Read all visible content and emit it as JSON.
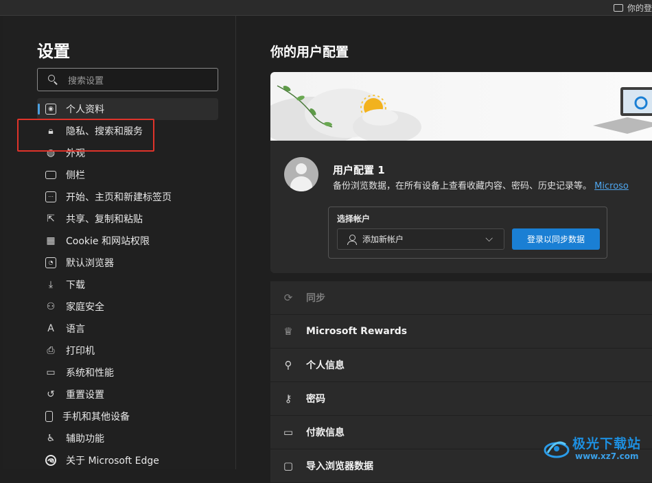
{
  "topbar": {
    "profile_label": "你的登"
  },
  "sidebar": {
    "title": "设置",
    "search_placeholder": "搜索设置",
    "items": [
      {
        "label": "个人资料",
        "icon": "profile-icon",
        "active": true
      },
      {
        "label": "隐私、搜索和服务",
        "icon": "lock-icon"
      },
      {
        "label": "外观",
        "icon": "palette-icon"
      },
      {
        "label": "侧栏",
        "icon": "sidebar-panel-icon"
      },
      {
        "label": "开始、主页和新建标签页",
        "icon": "home-tab-icon"
      },
      {
        "label": "共享、复制和粘贴",
        "icon": "share-icon"
      },
      {
        "label": "Cookie 和网站权限",
        "icon": "cookie-permissions-icon"
      },
      {
        "label": "默认浏览器",
        "icon": "default-browser-icon"
      },
      {
        "label": "下载",
        "icon": "download-icon"
      },
      {
        "label": "家庭安全",
        "icon": "family-icon"
      },
      {
        "label": "语言",
        "icon": "language-icon"
      },
      {
        "label": "打印机",
        "icon": "printer-icon"
      },
      {
        "label": "系统和性能",
        "icon": "laptop-icon"
      },
      {
        "label": "重置设置",
        "icon": "reset-icon"
      },
      {
        "label": "手机和其他设备",
        "icon": "phone-icon"
      },
      {
        "label": "辅助功能",
        "icon": "accessibility-icon"
      },
      {
        "label": "关于 Microsoft Edge",
        "icon": "edge-logo-icon"
      }
    ]
  },
  "main": {
    "title": "你的用户配置",
    "profile": {
      "name": "用户配置 1",
      "description": "备份浏览数据，在所有设备上查看收藏内容、密码、历史记录等。",
      "link": "Microso",
      "account_label": "选择帐户",
      "account_value": "添加新帐户",
      "sync_button": "登录以同步数据"
    },
    "rows": [
      {
        "label": "同步",
        "icon": "sync-icon",
        "disabled": true
      },
      {
        "label": "Microsoft Rewards",
        "icon": "rewards-icon"
      },
      {
        "label": "个人信息",
        "icon": "personal-info-icon"
      },
      {
        "label": "密码",
        "icon": "key-icon"
      },
      {
        "label": "付款信息",
        "icon": "card-icon"
      },
      {
        "label": "导入浏览器数据",
        "icon": "import-icon"
      }
    ]
  },
  "watermark": {
    "name": "极光下载站",
    "url": "www.xz7.com"
  },
  "colors": {
    "accent": "#1a7fd4",
    "highlight": "#e0332a",
    "link": "#4fa6ee"
  }
}
